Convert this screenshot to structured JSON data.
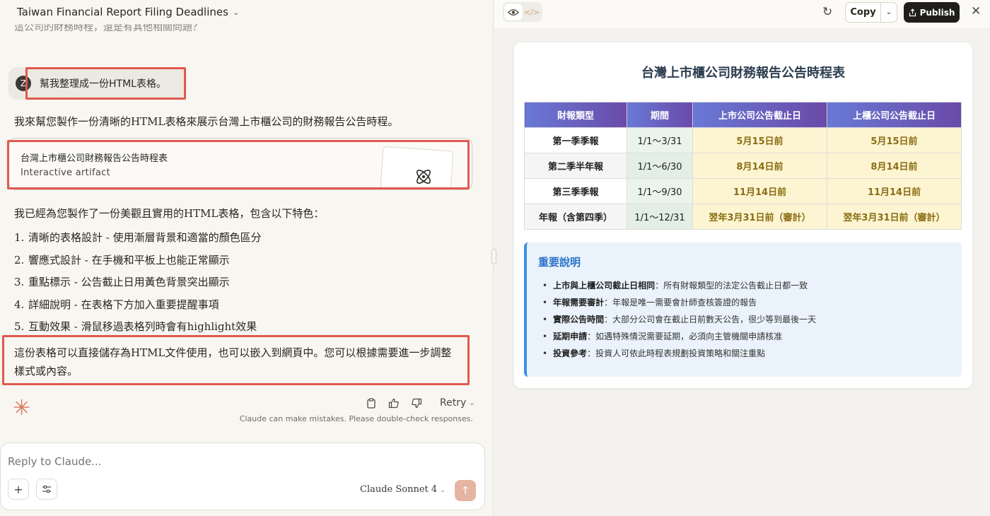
{
  "chat": {
    "title": "Taiwan Financial Report Filing Deadlines",
    "cut_previous": "這公司的財務時程，還是有其他相關問題？",
    "user_message": {
      "avatar": "Z",
      "text": "幫我整理成一份HTML表格。"
    },
    "intro": "我來幫您製作一份清晰的HTML表格來展示台灣上市櫃公司的財務報告公告時程。",
    "artifact_card": {
      "title": "台灣上市櫃公司財務報告公告時程表",
      "subtitle": "Interactive artifact"
    },
    "made_text": "我已經為您製作了一份美觀且實用的HTML表格，包含以下特色：",
    "features": [
      {
        "num": "1.",
        "text": "清晰的表格設計 - 使用漸層背景和適當的顏色區分"
      },
      {
        "num": "2.",
        "text": "響應式設計 - 在手機和平板上也能正常顯示"
      },
      {
        "num": "3.",
        "text": "重點標示 - 公告截止日用黃色背景突出顯示"
      },
      {
        "num": "4.",
        "text": "詳細說明 - 在表格下方加入重要提醒事項"
      },
      {
        "num": "5.",
        "text": "互動效果 - 滑鼠移過表格列時會有highlight效果"
      }
    ],
    "final_text": "這份表格可以直接儲存為HTML文件使用，也可以嵌入到網頁中。您可以根據需要進一步調整樣式或內容。",
    "actions": {
      "retry_label": "Retry"
    },
    "disclaimer": "Claude can make mistakes. Please double-check responses.",
    "input": {
      "placeholder": "Reply to Claude...",
      "model_label": "Claude Sonnet 4"
    },
    "colors": {
      "highlight_box": "#e0594e",
      "accent": "#d97757"
    }
  },
  "artifact": {
    "toolbar": {
      "copy_label": "Copy",
      "publish_label": "Publish"
    },
    "title": "台灣上市櫃公司財務報告公告時程表",
    "table": {
      "headers": [
        "財報類型",
        "期間",
        "上市公司公告截止日",
        "上櫃公司公告截止日"
      ],
      "rows": [
        [
          "第一季季報",
          "1/1～3/31",
          "5月15日前",
          "5月15日前"
        ],
        [
          "第二季半年報",
          "1/1～6/30",
          "8月14日前",
          "8月14日前"
        ],
        [
          "第三季季報",
          "1/1～9/30",
          "11月14日前",
          "11月14日前"
        ],
        [
          "年報（含第四季）",
          "1/1～12/31",
          "翌年3月31日前（審計）",
          "翌年3月31日前（審計）"
        ]
      ]
    },
    "notes": {
      "title": "重要說明",
      "items": [
        {
          "label": "上市與上櫃公司截止日相同",
          "text": "：所有財報類型的法定公告截止日都一致"
        },
        {
          "label": "年報需要審計",
          "text": "：年報是唯一需要會計師查核簽證的報告"
        },
        {
          "label": "實際公告時間",
          "text": "：大部分公司會在截止日前數天公告，很少等到最後一天"
        },
        {
          "label": "延期申請",
          "text": "：如遇特殊情況需要延期，必須向主管機關申請核准"
        },
        {
          "label": "投資參考",
          "text": "：投資人可依此時程表規劃投資策略和關注重點"
        }
      ]
    },
    "colors": {
      "header_gradient_start": "#6979d6",
      "header_gradient_end": "#6a4aa8",
      "deadline_bg": "#fdf4d2",
      "period_bg": "#eaf4ec",
      "notes_bg": "#eaf3fb",
      "notes_accent": "#3f8ee6"
    }
  }
}
